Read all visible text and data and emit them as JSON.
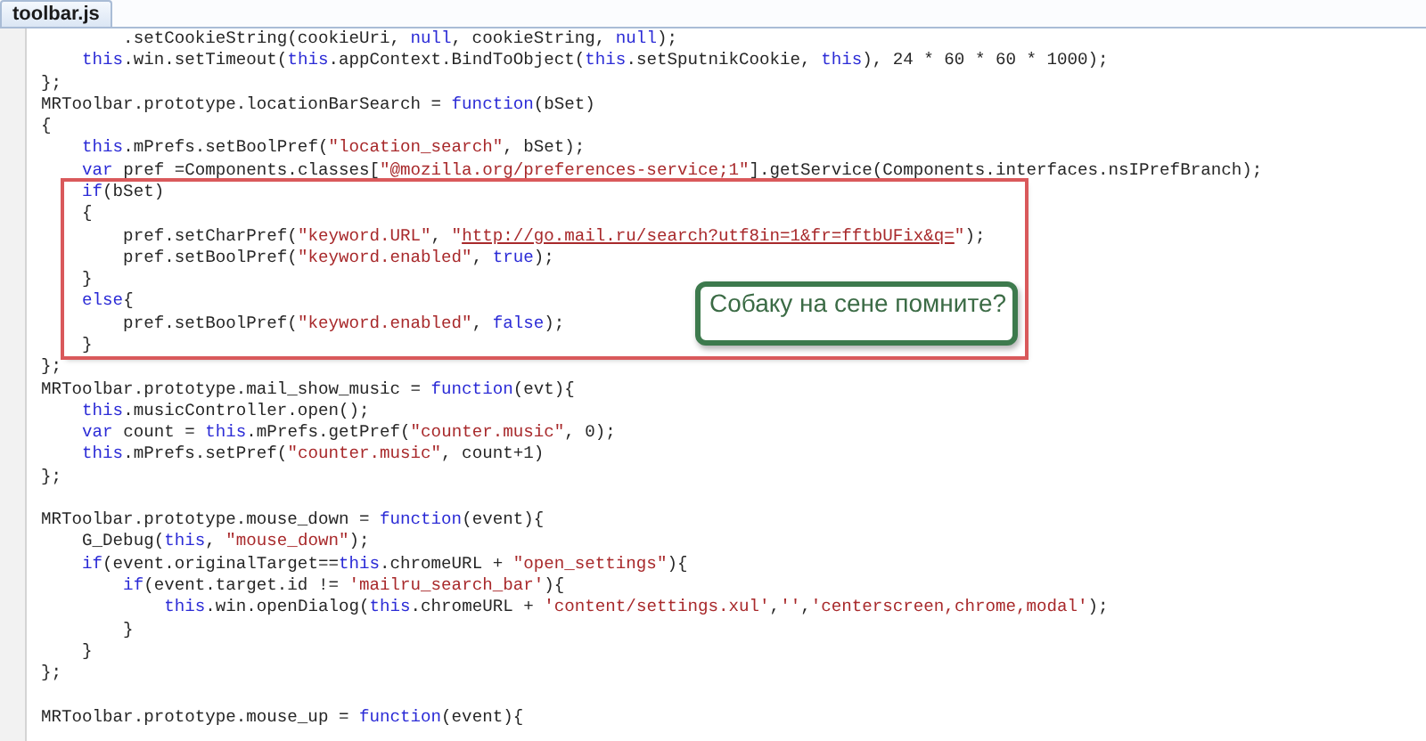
{
  "tab": {
    "label": "toolbar.js",
    "selected": true
  },
  "sections": [
    {
      "kind": "code",
      "lines": [
        [
          {
            "kind": "plain",
            "text": "        .setCookieString(cookieUri, "
          },
          {
            "kind": "keyword",
            "text": "null"
          },
          {
            "kind": "plain",
            "text": ", cookieString, "
          },
          {
            "kind": "keyword",
            "text": "null"
          },
          {
            "kind": "plain",
            "text": ");"
          }
        ],
        [
          {
            "kind": "keyword",
            "text": "    this"
          },
          {
            "kind": "plain",
            "text": ".win.setTimeout("
          },
          {
            "kind": "keyword",
            "text": "this"
          },
          {
            "kind": "plain",
            "text": ".appContext.BindToObject("
          },
          {
            "kind": "keyword",
            "text": "this"
          },
          {
            "kind": "plain",
            "text": ".setSputnikCookie, "
          },
          {
            "kind": "keyword",
            "text": "this"
          },
          {
            "kind": "plain",
            "text": "), 24 * 60 * 60 * 1000);"
          }
        ],
        [
          {
            "kind": "plain",
            "text": "};"
          }
        ],
        [
          {
            "kind": "plain",
            "text": "MRToolbar.prototype.locationBarSearch = "
          },
          {
            "kind": "keyword",
            "text": "function"
          },
          {
            "kind": "plain",
            "text": "(bSet)"
          }
        ],
        [
          {
            "kind": "plain",
            "text": "{"
          }
        ],
        [
          {
            "kind": "keyword",
            "text": "    this"
          },
          {
            "kind": "plain",
            "text": ".mPrefs.setBoolPref("
          },
          {
            "kind": "string",
            "text": "\"location_search\""
          },
          {
            "kind": "plain",
            "text": ", bSet);"
          }
        ],
        [
          {
            "kind": "keyword",
            "text": "    var"
          },
          {
            "kind": "plain",
            "text": " pref =Components.classes["
          },
          {
            "kind": "string",
            "text": "\"@mozilla.org/preferences-service;1\""
          },
          {
            "kind": "plain",
            "text": "].getService(Components.interfaces.nsIPrefBranch);"
          }
        ]
      ]
    },
    {
      "kind": "highlight",
      "callout": "Собаку на сене помните?",
      "lines": [
        [
          {
            "kind": "keyword",
            "text": "    if"
          },
          {
            "kind": "plain",
            "text": "(bSet)"
          }
        ],
        [
          {
            "kind": "plain",
            "text": "    {"
          }
        ],
        [
          {
            "kind": "plain",
            "text": "        pref.setCharPref("
          },
          {
            "kind": "string",
            "text": "\"keyword.URL\""
          },
          {
            "kind": "plain",
            "text": ", "
          },
          {
            "kind": "string",
            "text": "\""
          },
          {
            "kind": "link",
            "text": "http://go.mail.ru/search?utf8in=1&fr=fftbUFix&q="
          },
          {
            "kind": "string",
            "text": "\""
          },
          {
            "kind": "plain",
            "text": ");"
          }
        ],
        [
          {
            "kind": "plain",
            "text": "        pref.setBoolPref("
          },
          {
            "kind": "string",
            "text": "\"keyword.enabled\""
          },
          {
            "kind": "plain",
            "text": ", "
          },
          {
            "kind": "keyword",
            "text": "true"
          },
          {
            "kind": "plain",
            "text": ");"
          }
        ],
        [
          {
            "kind": "plain",
            "text": "    }"
          }
        ],
        [
          {
            "kind": "keyword",
            "text": "    else"
          },
          {
            "kind": "plain",
            "text": "{"
          }
        ],
        [
          {
            "kind": "plain",
            "text": "        pref.setBoolPref("
          },
          {
            "kind": "string",
            "text": "\"keyword.enabled\""
          },
          {
            "kind": "plain",
            "text": ", "
          },
          {
            "kind": "keyword",
            "text": "false"
          },
          {
            "kind": "plain",
            "text": ");"
          }
        ],
        [
          {
            "kind": "plain",
            "text": "    }"
          }
        ]
      ]
    },
    {
      "kind": "code",
      "lines": [
        [
          {
            "kind": "plain",
            "text": "};"
          }
        ],
        [
          {
            "kind": "plain",
            "text": "MRToolbar.prototype.mail_show_music = "
          },
          {
            "kind": "keyword",
            "text": "function"
          },
          {
            "kind": "plain",
            "text": "(evt){"
          }
        ],
        [
          {
            "kind": "keyword",
            "text": "    this"
          },
          {
            "kind": "plain",
            "text": ".musicController.open();"
          }
        ],
        [
          {
            "kind": "keyword",
            "text": "    var"
          },
          {
            "kind": "plain",
            "text": " count = "
          },
          {
            "kind": "keyword",
            "text": "this"
          },
          {
            "kind": "plain",
            "text": ".mPrefs.getPref("
          },
          {
            "kind": "string",
            "text": "\"counter.music\""
          },
          {
            "kind": "plain",
            "text": ", 0);"
          }
        ],
        [
          {
            "kind": "keyword",
            "text": "    this"
          },
          {
            "kind": "plain",
            "text": ".mPrefs.setPref("
          },
          {
            "kind": "string",
            "text": "\"counter.music\""
          },
          {
            "kind": "plain",
            "text": ", count+1)"
          }
        ],
        [
          {
            "kind": "plain",
            "text": "};"
          }
        ]
      ]
    },
    {
      "kind": "blank"
    },
    {
      "kind": "code",
      "lines": [
        [
          {
            "kind": "plain",
            "text": "MRToolbar.prototype.mouse_down = "
          },
          {
            "kind": "keyword",
            "text": "function"
          },
          {
            "kind": "plain",
            "text": "(event){"
          }
        ],
        [
          {
            "kind": "plain",
            "text": "    G_Debug("
          },
          {
            "kind": "keyword",
            "text": "this"
          },
          {
            "kind": "plain",
            "text": ", "
          },
          {
            "kind": "string",
            "text": "\"mouse_down\""
          },
          {
            "kind": "plain",
            "text": ");"
          }
        ],
        [
          {
            "kind": "keyword",
            "text": "    if"
          },
          {
            "kind": "plain",
            "text": "(event.originalTarget=="
          },
          {
            "kind": "keyword",
            "text": "this"
          },
          {
            "kind": "plain",
            "text": ".chromeURL + "
          },
          {
            "kind": "string",
            "text": "\"open_settings\""
          },
          {
            "kind": "plain",
            "text": "){"
          }
        ],
        [
          {
            "kind": "keyword",
            "text": "        if"
          },
          {
            "kind": "plain",
            "text": "(event.target.id != "
          },
          {
            "kind": "string",
            "text": "'mailru_search_bar'"
          },
          {
            "kind": "plain",
            "text": "){"
          }
        ],
        [
          {
            "kind": "keyword",
            "text": "            this"
          },
          {
            "kind": "plain",
            "text": ".win.openDialog("
          },
          {
            "kind": "keyword",
            "text": "this"
          },
          {
            "kind": "plain",
            "text": ".chromeURL + "
          },
          {
            "kind": "string",
            "text": "'content/settings.xul'"
          },
          {
            "kind": "plain",
            "text": ","
          },
          {
            "kind": "string",
            "text": "''"
          },
          {
            "kind": "plain",
            "text": ","
          },
          {
            "kind": "string",
            "text": "'centerscreen,chrome,modal'"
          },
          {
            "kind": "plain",
            "text": ");"
          }
        ],
        [
          {
            "kind": "plain",
            "text": "        }"
          }
        ],
        [
          {
            "kind": "plain",
            "text": "    }"
          }
        ],
        [
          {
            "kind": "plain",
            "text": "};"
          }
        ]
      ]
    },
    {
      "kind": "blank"
    },
    {
      "kind": "code",
      "lines": [
        [
          {
            "kind": "plain",
            "text": "MRToolbar.prototype.mouse_up = "
          },
          {
            "kind": "keyword",
            "text": "function"
          },
          {
            "kind": "plain",
            "text": "(event){"
          }
        ]
      ]
    }
  ]
}
